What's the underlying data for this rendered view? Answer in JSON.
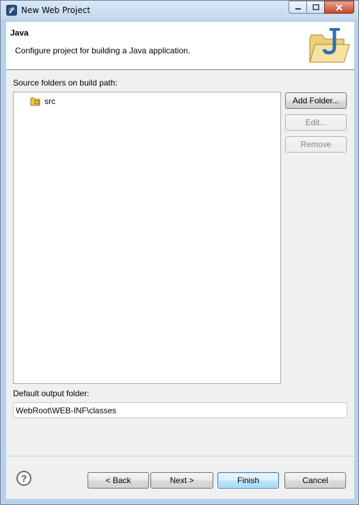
{
  "window": {
    "title": "New Web Project",
    "app_icon": "eclipse-icon"
  },
  "header": {
    "title": "Java",
    "description": "Configure project for building a Java application.",
    "banner_icon": "java-folder-icon"
  },
  "source": {
    "label": "Source folders on build path:",
    "folders": [
      {
        "name": "src",
        "icon": "source-folder-icon"
      }
    ],
    "buttons": {
      "add": "Add Folder...",
      "edit": "Edit...",
      "remove": "Remove"
    }
  },
  "output": {
    "label": "Default output folder:",
    "value": "WebRoot\\WEB-INF\\classes"
  },
  "footer": {
    "help_icon": "help-icon",
    "back": "< Back",
    "next": "Next >",
    "finish": "Finish",
    "cancel": "Cancel"
  }
}
